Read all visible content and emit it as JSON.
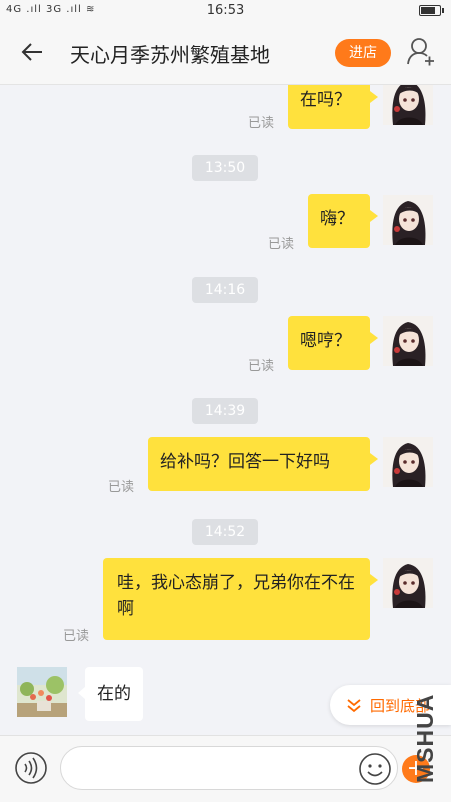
{
  "status": {
    "left": "4G .ıll 3G .ıll ≋",
    "time": "16:53",
    "battery_level": 0.85
  },
  "header": {
    "title": "天心月季苏州繁殖基地",
    "shop_button": "进店"
  },
  "messages": [
    {
      "type": "me",
      "text": "在吗？",
      "read": "已读"
    },
    {
      "type": "time",
      "text": "13:50"
    },
    {
      "type": "me",
      "text": "嗨？",
      "read": "已读"
    },
    {
      "type": "time",
      "text": "14:16"
    },
    {
      "type": "me",
      "text": "嗯哼？",
      "read": "已读"
    },
    {
      "type": "time",
      "text": "14:39"
    },
    {
      "type": "me",
      "text": "给补吗？回答一下好吗",
      "read": "已读"
    },
    {
      "type": "time",
      "text": "14:52"
    },
    {
      "type": "me",
      "text": "哇，我心态崩了，兄弟你在不在啊",
      "read": "已读"
    },
    {
      "type": "other",
      "text": "在的"
    }
  ],
  "back_to_bottom": "回到底部",
  "input": {
    "placeholder": ""
  },
  "watermark": "MSHUA",
  "colors": {
    "accent": "#ff7a1a",
    "my_bubble": "#ffe13d"
  }
}
